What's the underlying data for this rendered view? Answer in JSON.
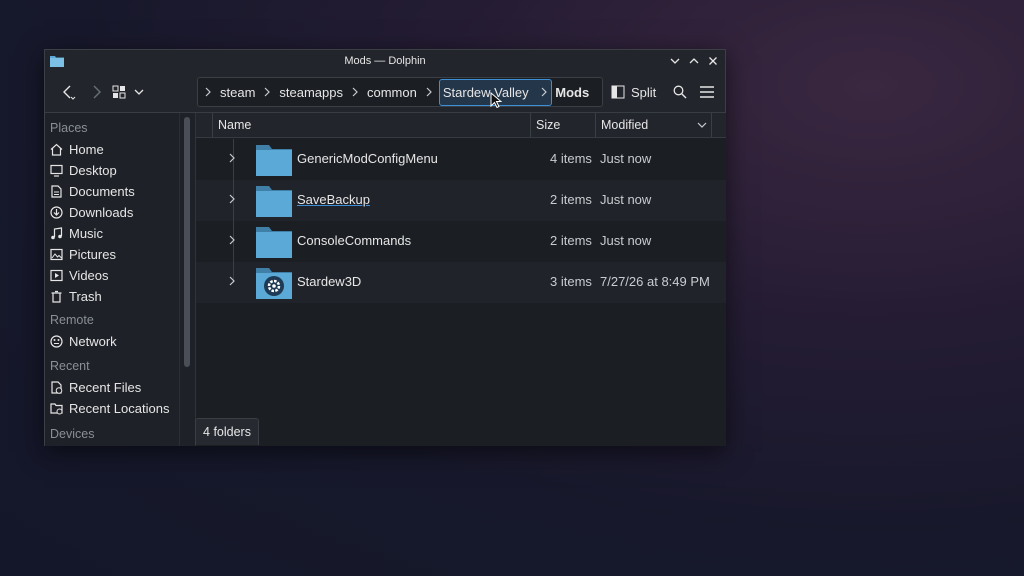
{
  "window": {
    "title": "Mods — Dolphin"
  },
  "breadcrumb": {
    "items": [
      "steam",
      "steamapps",
      "common",
      "Stardew Valley"
    ],
    "current": "Mods"
  },
  "toolbar": {
    "split_label": "Split"
  },
  "sidebar": {
    "places_header": "Places",
    "places": [
      {
        "label": "Home",
        "icon": "home-icon"
      },
      {
        "label": "Desktop",
        "icon": "desktop-icon"
      },
      {
        "label": "Documents",
        "icon": "documents-icon"
      },
      {
        "label": "Downloads",
        "icon": "downloads-icon"
      },
      {
        "label": "Music",
        "icon": "music-icon"
      },
      {
        "label": "Pictures",
        "icon": "pictures-icon"
      },
      {
        "label": "Videos",
        "icon": "videos-icon"
      },
      {
        "label": "Trash",
        "icon": "trash-icon"
      }
    ],
    "remote_header": "Remote",
    "remote": [
      {
        "label": "Network",
        "icon": "network-icon"
      }
    ],
    "recent_header": "Recent",
    "recent": [
      {
        "label": "Recent Files",
        "icon": "recent-files-icon"
      },
      {
        "label": "Recent Locations",
        "icon": "recent-locations-icon"
      }
    ],
    "devices_header": "Devices"
  },
  "columns": {
    "name": "Name",
    "size": "Size",
    "modified": "Modified"
  },
  "files": [
    {
      "name": "GenericModConfigMenu",
      "size": "4 items",
      "modified": "Just now"
    },
    {
      "name": "SaveBackup",
      "size": "2 items",
      "modified": "Just now"
    },
    {
      "name": "ConsoleCommands",
      "size": "2 items",
      "modified": "Just now"
    },
    {
      "name": "Stardew3D",
      "size": "3 items",
      "modified": "7/27/26 at 8:49 PM"
    }
  ],
  "status": {
    "text": "4 folders"
  },
  "colors": {
    "folder": "#5aa9d6",
    "accent": "#3d8fd6"
  }
}
